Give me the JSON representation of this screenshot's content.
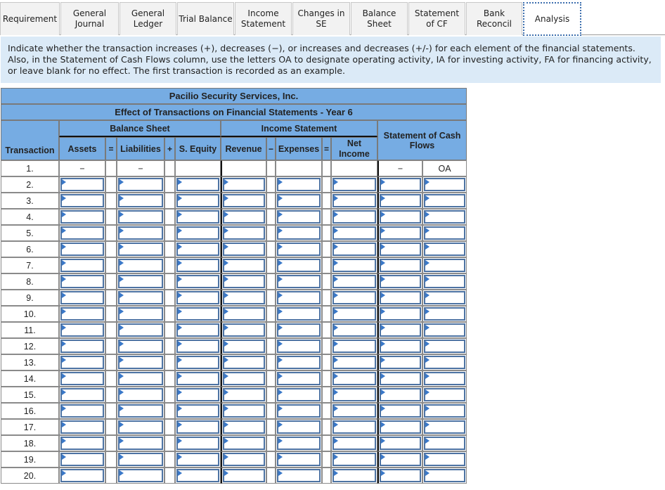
{
  "tabs": [
    {
      "label": "Requirement",
      "active": false
    },
    {
      "label": "General\nJournal",
      "active": false
    },
    {
      "label": "General\nLedger",
      "active": false
    },
    {
      "label": "Trial Balance",
      "active": false
    },
    {
      "label": "Income\nStatement",
      "active": false
    },
    {
      "label": "Changes in\nSE",
      "active": false
    },
    {
      "label": "Balance\nSheet",
      "active": false
    },
    {
      "label": "Statement\nof CF",
      "active": false
    },
    {
      "label": "Bank\nReconcil",
      "active": false
    },
    {
      "label": "Analysis",
      "active": true
    }
  ],
  "instructions": "Indicate whether the transaction increases (+), decreases (−), or increases and decreases (+/-) for each element of the financial statements. Also, in the Statement of Cash Flows column, use the letters OA to designate operating activity, IA for investing activity, FA for financing activity, or leave blank for no effect. The first transaction is recorded as an example.",
  "table": {
    "company": "Pacilio Security Services, Inc.",
    "subtitle": "Effect of Transactions on Financial Statements - Year 6",
    "groups": {
      "balance_sheet": "Balance Sheet",
      "income_statement": "Income Statement",
      "cash_flows": "Statement of Cash Flows"
    },
    "columns": {
      "transaction": "Transaction",
      "assets": "Assets",
      "eq1": "=",
      "liabilities": "Liabilities",
      "plus": "+",
      "equity": "S. Equity",
      "revenue": "Revenue",
      "minus": "−",
      "expenses": "Expenses",
      "eq2": "=",
      "net_income": "Net Income"
    },
    "example_row": {
      "number": "1.",
      "assets": "−",
      "liabilities": "−",
      "equity": "",
      "revenue": "",
      "expenses": "",
      "net_income": "",
      "cf_effect": "−",
      "cf_activity": "OA"
    },
    "input_rows": [
      {
        "number": "2."
      },
      {
        "number": "3."
      },
      {
        "number": "4."
      },
      {
        "number": "5."
      },
      {
        "number": "6."
      },
      {
        "number": "7."
      },
      {
        "number": "8."
      },
      {
        "number": "9."
      },
      {
        "number": "10."
      },
      {
        "number": "11."
      },
      {
        "number": "12."
      },
      {
        "number": "13."
      },
      {
        "number": "14."
      },
      {
        "number": "15."
      },
      {
        "number": "16."
      },
      {
        "number": "17."
      },
      {
        "number": "18."
      },
      {
        "number": "19."
      },
      {
        "number": "20."
      }
    ]
  }
}
